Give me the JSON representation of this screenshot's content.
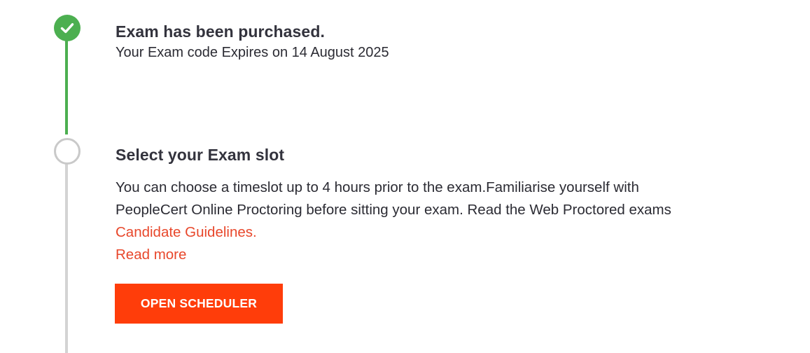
{
  "steps": [
    {
      "status": "completed",
      "icon": "check-icon",
      "title": "Exam has been purchased.",
      "subtitle": "Your Exam code Expires on 14 August 2025"
    },
    {
      "status": "pending",
      "icon": "empty-circle-icon",
      "title": "Select your Exam slot",
      "description_line1": "You can choose a timeslot up to 4 hours prior to the exam.Familiarise yourself with",
      "description_line2": "PeopleCert Online Proctoring before sitting your exam. Read the Web Proctored exams",
      "guidelines_link": "Candidate Guidelines.",
      "read_more_link": "Read more",
      "button_label": "OPEN SCHEDULER"
    }
  ],
  "colors": {
    "completed": "#4caf50",
    "pending": "#c9c9c9",
    "accent": "#ff3d0a",
    "link": "#e8472b",
    "text": "#2b2b33"
  }
}
